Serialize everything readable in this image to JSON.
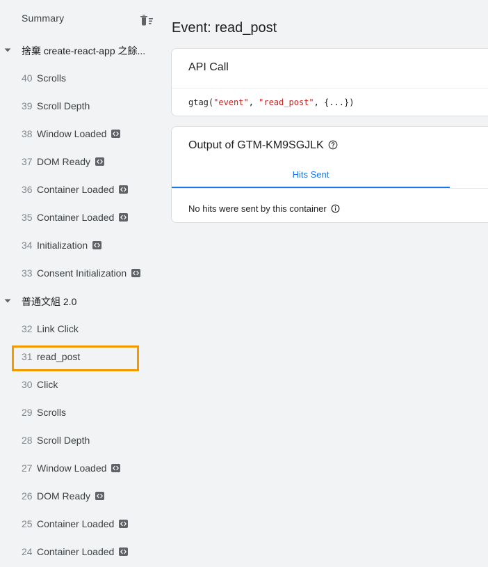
{
  "sidebar": {
    "summary_label": "Summary",
    "groups": [
      {
        "label": "捨棄 create-react-app 之餘...",
        "events": [
          {
            "num": "40",
            "name": "Scrolls",
            "code": false
          },
          {
            "num": "39",
            "name": "Scroll Depth",
            "code": false
          },
          {
            "num": "38",
            "name": "Window Loaded",
            "code": true
          },
          {
            "num": "37",
            "name": "DOM Ready",
            "code": true
          },
          {
            "num": "36",
            "name": "Container Loaded",
            "code": true
          },
          {
            "num": "35",
            "name": "Container Loaded",
            "code": true
          },
          {
            "num": "34",
            "name": "Initialization",
            "code": true
          },
          {
            "num": "33",
            "name": "Consent Initialization",
            "code": true
          }
        ]
      },
      {
        "label": "普通文組 2.0",
        "events": [
          {
            "num": "32",
            "name": "Link Click",
            "code": false
          },
          {
            "num": "31",
            "name": "read_post",
            "code": false
          },
          {
            "num": "30",
            "name": "Click",
            "code": false
          },
          {
            "num": "29",
            "name": "Scrolls",
            "code": false
          },
          {
            "num": "28",
            "name": "Scroll Depth",
            "code": false
          },
          {
            "num": "27",
            "name": "Window Loaded",
            "code": true
          },
          {
            "num": "26",
            "name": "DOM Ready",
            "code": true
          },
          {
            "num": "25",
            "name": "Container Loaded",
            "code": true
          },
          {
            "num": "24",
            "name": "Container Loaded",
            "code": true
          }
        ]
      }
    ],
    "selected_event": "31"
  },
  "main": {
    "event_title": "Event: read_post",
    "api_card": {
      "title": "API Call",
      "code_fn": "gtag(",
      "code_arg1": "\"event\"",
      "code_sep1": ", ",
      "code_arg2": "\"read_post\"",
      "code_rest": ", {...})"
    },
    "output_card": {
      "title": "Output of GTM-KM9SGJLK",
      "tab_label": "Hits Sent",
      "no_hits_text": "No hits were sent by this container"
    }
  },
  "colors": {
    "accent": "#1a73e8",
    "highlight": "#f29900",
    "code_string": "#c5221f"
  },
  "icons": {
    "summary_action": "delete-sweep-icon",
    "group_toggle": "caret-down-icon",
    "event_badge": "code-icon",
    "help": "help-circle-icon",
    "info": "info-circle-icon"
  }
}
